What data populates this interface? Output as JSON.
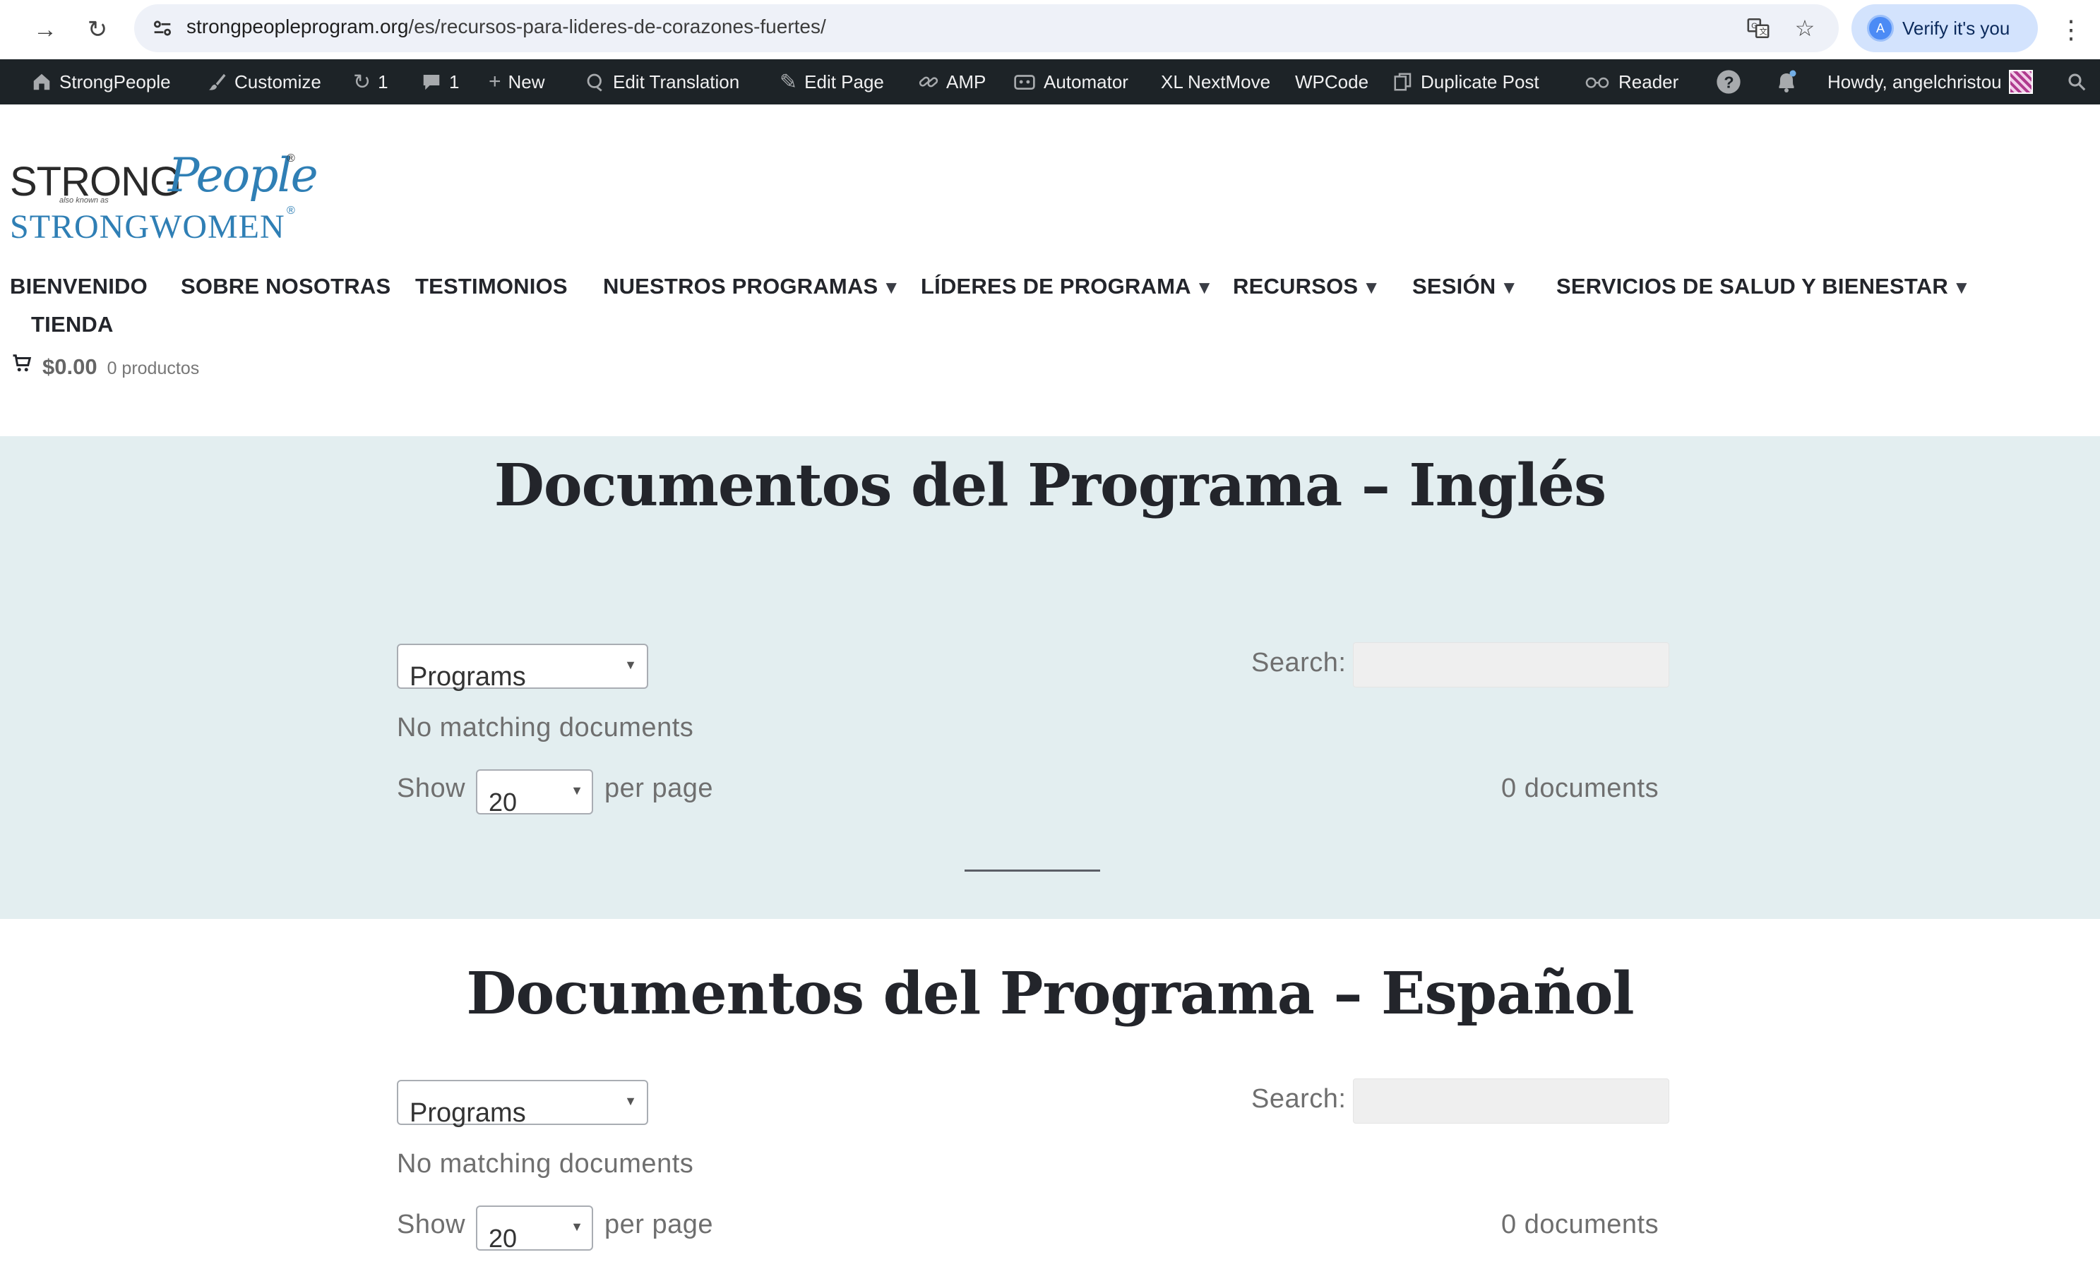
{
  "browser": {
    "url_host": "strongpeopleprogram.org",
    "url_path": "/es/recursos-para-lideres-de-corazones-fuertes/",
    "verify_label": "Verify it's you",
    "profile_initial": "A"
  },
  "adminbar": {
    "site": "StrongPeople",
    "customize": "Customize",
    "updates": "1",
    "comments": "1",
    "new": "New",
    "edit_translation": "Edit Translation",
    "edit_page": "Edit Page",
    "amp": "AMP",
    "automator": "Automator",
    "xl_nextmove": "XL NextMove",
    "wpcode": "WPCode",
    "duplicate_post": "Duplicate Post",
    "reader": "Reader",
    "howdy": "Howdy, angelchristou"
  },
  "logo": {
    "strong": "STRONG",
    "people": "People",
    "reg": "®",
    "aka": "also known as",
    "strong_women": "STRONGWOMEN"
  },
  "nav": {
    "items": [
      {
        "label": "BIENVENIDO",
        "caret": ""
      },
      {
        "label": "SOBRE NOSOTRAS",
        "caret": ""
      },
      {
        "label": "TESTIMONIOS",
        "caret": ""
      },
      {
        "label": "NUESTROS PROGRAMAS",
        "caret": "▼"
      },
      {
        "label": "LÍDERES DE PROGRAMA",
        "caret": "▼"
      },
      {
        "label": "RECURSOS",
        "caret": "▼"
      },
      {
        "label": "SESIÓN",
        "caret": "▼"
      },
      {
        "label": "SERVICIOS DE SALUD Y BIENESTAR",
        "caret": "▼"
      },
      {
        "label": "TIENDA",
        "caret": ""
      }
    ],
    "cart_amount": "$0.00",
    "cart_count": "0 productos"
  },
  "sections": [
    {
      "title": "Documentos del Programa – Inglés",
      "filter_value": "Programs",
      "search_label": "Search:",
      "search_value": "",
      "empty_text": "No matching documents",
      "show_label": "Show",
      "per_page_value": "20",
      "per_page_label": "per page",
      "count_text": "0 documents"
    },
    {
      "title": "Documentos del Programa – Español",
      "filter_value": "Programs",
      "search_label": "Search:",
      "search_value": "",
      "empty_text": "No matching documents",
      "show_label": "Show",
      "per_page_value": "20",
      "per_page_label": "per page",
      "count_text": "0 documents"
    }
  ],
  "colors": {
    "band_bg": "#e3eef0",
    "adminbar_bg": "#1d2327",
    "logo_blue": "#2f7fb5",
    "title_color": "#23252b"
  }
}
